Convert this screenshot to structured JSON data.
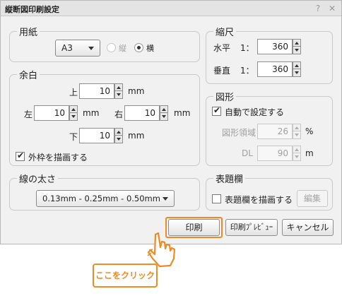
{
  "window": {
    "title": "縦断図印刷設定",
    "help_icon": "?",
    "close_icon": "✕"
  },
  "paper": {
    "group_label": "用紙",
    "size_value": "A3",
    "orientation_portrait_label": "縦",
    "orientation_landscape_label": "横",
    "selected_orientation": "横"
  },
  "margin": {
    "group_label": "余白",
    "top_label": "上",
    "top_value": "10",
    "left_label": "左",
    "left_value": "10",
    "right_label": "右",
    "right_value": "10",
    "bottom_label": "下",
    "bottom_value": "10",
    "unit": "mm",
    "outer_frame_label": "外枠を描画する",
    "outer_frame_checked": true
  },
  "scale": {
    "group_label": "縮尺",
    "horizontal_label": "水平",
    "horizontal_prefix": "1：",
    "horizontal_value": "360",
    "vertical_label": "垂直",
    "vertical_prefix": "1：",
    "vertical_value": "360"
  },
  "figure": {
    "group_label": "図形",
    "auto_label": "自動で設定する",
    "auto_checked": true,
    "area_label": "図形領域",
    "area_value": "26",
    "area_unit": "%",
    "dl_label": "DL",
    "dl_value": "90",
    "dl_unit": "m"
  },
  "line_width": {
    "group_label": "線の太さ",
    "value": "0.13mm - 0.25mm - 0.50mm"
  },
  "title_block": {
    "group_label": "表題欄",
    "draw_label": "表題欄を描画する",
    "draw_checked": false,
    "edit_label": "編集"
  },
  "buttons": {
    "print_label": "印刷",
    "preview_label": "印刷ﾌﾟﾚﾋﾞｭｰ",
    "cancel_label": "キャンセル"
  },
  "annotation": {
    "callout_text": "ここをクリック",
    "highlight_color": "#f08a24"
  }
}
